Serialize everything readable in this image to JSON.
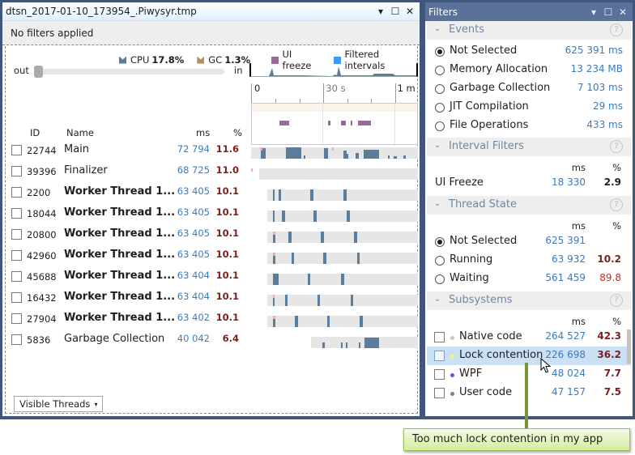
{
  "left_window": {
    "title": "dtsn_2017-01-10_173954_.Piwysyr.tmp",
    "title_buttons": {
      "dropdown": "▾",
      "maximize": "☐",
      "close": "✕"
    },
    "filter_status": "No filters applied",
    "legend": [
      {
        "label": "CPU",
        "value": "17.8%",
        "color": "#5b7d9b",
        "icon": "cpu-area-icon"
      },
      {
        "label": "GC",
        "value": "1.3%",
        "color": "#b98d5b",
        "icon": "gc-area-icon"
      },
      {
        "label": "UI freeze",
        "value": "",
        "color": "#9a6b9a",
        "icon": "ui-freeze-swatch"
      },
      {
        "label": "Filtered intervals",
        "value": "",
        "color": "#3d9af1",
        "icon": "filtered-intervals-swatch"
      }
    ],
    "zoom": {
      "out_label": "out",
      "in_label": "in",
      "level": 0.0
    },
    "timeline": {
      "ticks": [
        {
          "label": "0",
          "t": 0,
          "muted": false
        },
        {
          "label": "30 s",
          "t": 30,
          "muted": true
        },
        {
          "label": "1 m",
          "t": 60,
          "muted": false
        }
      ],
      "range_seconds": 70,
      "ui_freezes_s": [
        [
          11.5,
          15.8
        ],
        [
          31.8,
          32.8
        ],
        [
          37.5,
          39.3
        ],
        [
          41.5,
          42.3
        ],
        [
          44.5,
          49.8
        ]
      ]
    },
    "table": {
      "headers": {
        "id": "ID",
        "name": "Name",
        "ms": "ms",
        "pct": "%"
      },
      "rows": [
        {
          "id": "22744",
          "name": "Main",
          "bold": false,
          "ms": "72 794",
          "pct": "11.6",
          "start": 0.0,
          "segs": [
            [
              3.0,
              1.5,
              0.9
            ],
            [
              11.0,
              4.8,
              1.0
            ],
            [
              16.5,
              0.5,
              0.3
            ],
            [
              23.0,
              1.3,
              0.9
            ],
            [
              29.0,
              1.0,
              0.7
            ],
            [
              30.0,
              0.6,
              0.4
            ],
            [
              33.0,
              1.0,
              0.5
            ],
            [
              35.5,
              4.8,
              0.8
            ],
            [
              43.0,
              0.5,
              0.3
            ],
            [
              45.0,
              1.0,
              0.2
            ],
            [
              48.0,
              0.6,
              0.3
            ]
          ],
          "pinks": [
            [
              2.8,
              0.8
            ],
            [
              25.5,
              0.6
            ]
          ]
        },
        {
          "id": "39396",
          "name": "Finalizer",
          "bold": false,
          "ms": "68 725",
          "pct": "11.0",
          "start": 0.05,
          "segs": [],
          "pinks": [
            [
              0.05,
              0.2
            ]
          ]
        },
        {
          "id": "2200",
          "name": "Worker Thread 1...",
          "bold": true,
          "ms": "63 405",
          "pct": "10.1",
          "start": 0.1,
          "segs": [
            [
              7.0,
              0.5,
              1
            ],
            [
              8.6,
              0.9,
              1
            ],
            [
              18.6,
              1.1,
              1
            ],
            [
              29.0,
              1.1,
              1
            ]
          ],
          "pinks": []
        },
        {
          "id": "18044",
          "name": "Worker Thread 1...",
          "bold": true,
          "ms": "63 405",
          "pct": "10.1",
          "start": 0.1,
          "segs": [
            [
              7.0,
              0.5,
              1
            ],
            [
              9.6,
              1.1,
              1
            ],
            [
              19.7,
              0.9,
              1
            ],
            [
              30.1,
              0.9,
              1
            ]
          ],
          "pinks": []
        },
        {
          "id": "20800",
          "name": "Worker Thread 1...",
          "bold": true,
          "ms": "63 405",
          "pct": "10.1",
          "start": 0.1,
          "segs": [
            [
              7.0,
              0.6,
              0.9
            ],
            [
              11.7,
              1.1,
              1
            ],
            [
              21.9,
              1.1,
              1
            ],
            [
              32.3,
              1.1,
              1
            ]
          ],
          "pinks": [
            [
              7.0,
              0.6
            ]
          ]
        },
        {
          "id": "42960",
          "name": "Worker Thread 1...",
          "bold": true,
          "ms": "63 405",
          "pct": "10.1",
          "start": 0.1,
          "segs": [
            [
              7.0,
              0.6,
              0.9
            ],
            [
              12.8,
              0.8,
              1
            ],
            [
              22.7,
              1.1,
              1
            ],
            [
              33.3,
              0.8,
              1
            ]
          ],
          "pinks": [
            [
              7.0,
              0.6
            ]
          ]
        },
        {
          "id": "45688",
          "name": "Worker Thread 1...",
          "bold": true,
          "ms": "63 404",
          "pct": "10.1",
          "start": 0.1,
          "segs": [
            [
              7.0,
              1.6,
              1
            ],
            [
              17.8,
              0.9,
              1
            ],
            [
              28.2,
              1.1,
              1
            ]
          ],
          "pinks": []
        },
        {
          "id": "16432",
          "name": "Worker Thread 1...",
          "bold": true,
          "ms": "63 404",
          "pct": "10.1",
          "start": 0.1,
          "segs": [
            [
              7.0,
              0.4,
              0.8
            ],
            [
              10.8,
              0.8,
              1
            ],
            [
              20.9,
              0.9,
              1
            ],
            [
              31.3,
              0.9,
              1
            ]
          ],
          "pinks": [
            [
              7.0,
              0.3
            ]
          ]
        },
        {
          "id": "27904",
          "name": "Worker Thread 1...",
          "bold": true,
          "ms": "63 402",
          "pct": "10.1",
          "start": 0.1,
          "segs": [
            [
              7.0,
              0.7,
              0.8
            ],
            [
              13.8,
              1.1,
              1
            ],
            [
              23.9,
              0.9,
              1
            ],
            [
              34.2,
              1.1,
              1
            ]
          ],
          "pinks": [
            [
              7.0,
              0.7
            ]
          ]
        },
        {
          "id": "5836",
          "name": "Garbage Collection",
          "bold": false,
          "ms": "40 042",
          "pct": "6.4",
          "start": 0.38,
          "segs": [
            [
              22.5,
              0.8,
              0.5
            ],
            [
              28.3,
              0.6,
              0.5
            ],
            [
              29.9,
              0.2,
              0.5
            ],
            [
              34.0,
              0.2,
              0.5
            ],
            [
              35.8,
              4.6,
              0.9
            ]
          ],
          "pinks": []
        }
      ]
    },
    "visible_threads_button": "Visible Threads",
    "visible_threads_caret": "▾"
  },
  "filters_window": {
    "title": "Filters",
    "title_buttons": {
      "dropdown": "▾",
      "maximize": "☐",
      "close": "✕"
    },
    "help_glyph": "?",
    "chevron": "⌄",
    "events": {
      "label": "Events",
      "items": [
        {
          "label": "Not Selected",
          "value": "625 391 ms",
          "selected": true
        },
        {
          "label": "Memory Allocation",
          "value": "13 234 MB",
          "selected": false
        },
        {
          "label": "Garbage Collection",
          "value": "7 103 ms",
          "selected": false
        },
        {
          "label": "JIT Compilation",
          "value": "29 ms",
          "selected": false
        },
        {
          "label": "File Operations",
          "value": "433 ms",
          "selected": false
        }
      ]
    },
    "interval_filters": {
      "label": "Interval Filters",
      "col_ms": "ms",
      "col_pct": "%",
      "items": [
        {
          "label": "UI Freeze",
          "ms": "18 330",
          "pct": "2.9"
        }
      ]
    },
    "thread_state": {
      "label": "Thread State",
      "col_ms": "ms",
      "col_pct": "%",
      "items": [
        {
          "label": "Not Selected",
          "ms": "625 391",
          "pct": "",
          "selected": true
        },
        {
          "label": "Running",
          "ms": "63 932",
          "pct": "10.2",
          "selected": false
        },
        {
          "label": "Waiting",
          "ms": "561 459",
          "pct": "89.8",
          "selected": false
        }
      ]
    },
    "subsystems": {
      "label": "Subsystems",
      "col_ms": "ms",
      "col_pct": "%",
      "items": [
        {
          "label": "Native code",
          "ms": "264 527",
          "pct": "42.3",
          "dot": "#c8c8c8",
          "checked": false,
          "hover": false
        },
        {
          "label": "Lock contention",
          "ms": "226 698",
          "pct": "36.2",
          "dot": "#f5f571",
          "checked": false,
          "hover": true
        },
        {
          "label": "WPF",
          "ms": "48 024",
          "pct": "7.7",
          "dot": "#8a3cf0",
          "checked": false,
          "hover": false
        },
        {
          "label": "User code",
          "ms": "47 157",
          "pct": "7.5",
          "dot": "#808080",
          "checked": false,
          "hover": false
        }
      ]
    }
  },
  "callout": {
    "text": "Too much lock contention in my app"
  }
}
